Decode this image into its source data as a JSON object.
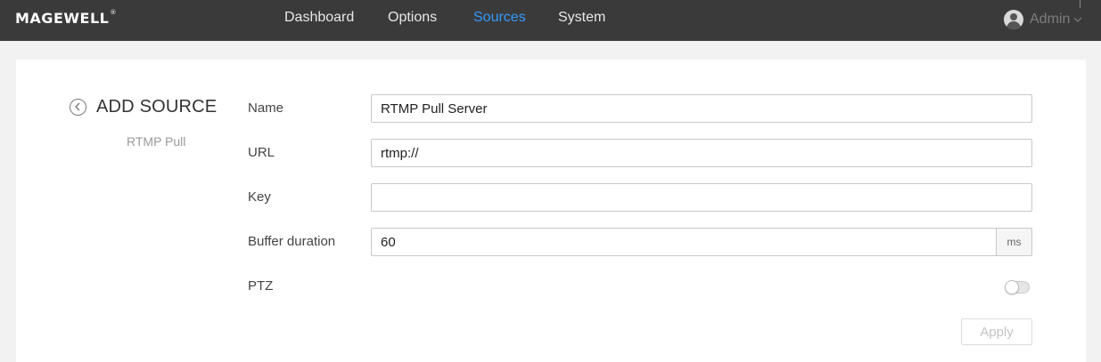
{
  "header": {
    "logo_text": "MAGEWELL",
    "logo_mark": "®",
    "nav": [
      {
        "label": "Dashboard",
        "active": false
      },
      {
        "label": "Options",
        "active": false
      },
      {
        "label": "Sources",
        "active": true
      },
      {
        "label": "System",
        "active": false
      }
    ],
    "user": {
      "name": "Admin",
      "icon": "user-avatar-icon",
      "menu_icon": "chevron-down-icon"
    },
    "colors": {
      "bar": "#3a3a3a",
      "active": "#3399ff"
    }
  },
  "page": {
    "back_icon": "chevron-left-circle-icon",
    "title": "ADD SOURCE",
    "subtitle": "RTMP Pull"
  },
  "form": {
    "name": {
      "label": "Name",
      "value": "RTMP Pull Server"
    },
    "url": {
      "label": "URL",
      "value": "rtmp://"
    },
    "key": {
      "label": "Key",
      "value": ""
    },
    "buffer": {
      "label": "Buffer duration",
      "value": "60",
      "unit": "ms"
    },
    "ptz": {
      "label": "PTZ",
      "enabled": false
    },
    "apply_label": "Apply"
  }
}
